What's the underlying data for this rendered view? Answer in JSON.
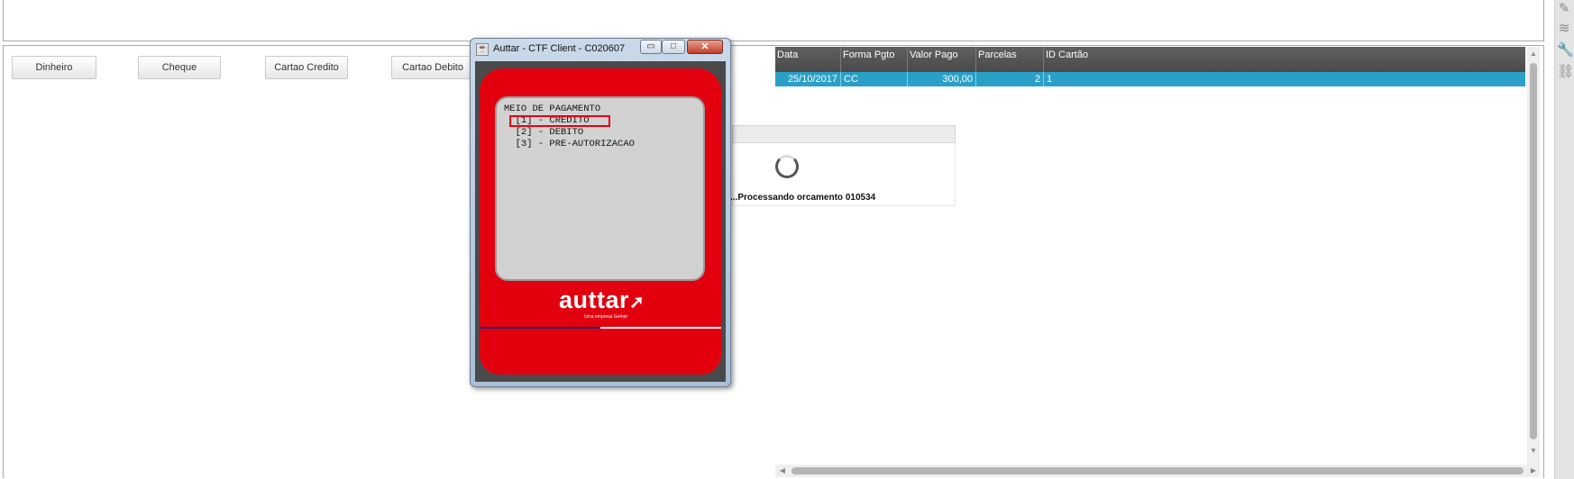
{
  "payment_buttons": [
    {
      "label": "Dinheiro"
    },
    {
      "label": "Cheque"
    },
    {
      "label": "Cartao Credito"
    },
    {
      "label": "Cartao Debito"
    }
  ],
  "grid": {
    "columns": [
      "Data",
      "Forma Pgto",
      "Valor Pago",
      "Parcelas",
      "ID Cartão"
    ],
    "rows": [
      {
        "data": "25/10/2017",
        "forma": "CC",
        "valor": "300,00",
        "parcelas": "2",
        "id_cartao": "1"
      }
    ],
    "selected_color": "#2aa0c8"
  },
  "processing": {
    "message": "...Processando orcamento 010534"
  },
  "dialog": {
    "title": "Auttar - CTF Client - C020607",
    "screen_lines": [
      "MEIO DE PAGAMENTO",
      "  [1] - CREDITO",
      "  [2] - DEBITO",
      "  [3] - PRE-AUTORIZACAO"
    ],
    "brand": "auttar",
    "brand_tagline": "Uma empresa Getnet",
    "accent_color": "#e2000f"
  },
  "toolbar_icons": [
    "edit-icon",
    "stack-icon",
    "wrench-icon",
    "link-icon"
  ]
}
